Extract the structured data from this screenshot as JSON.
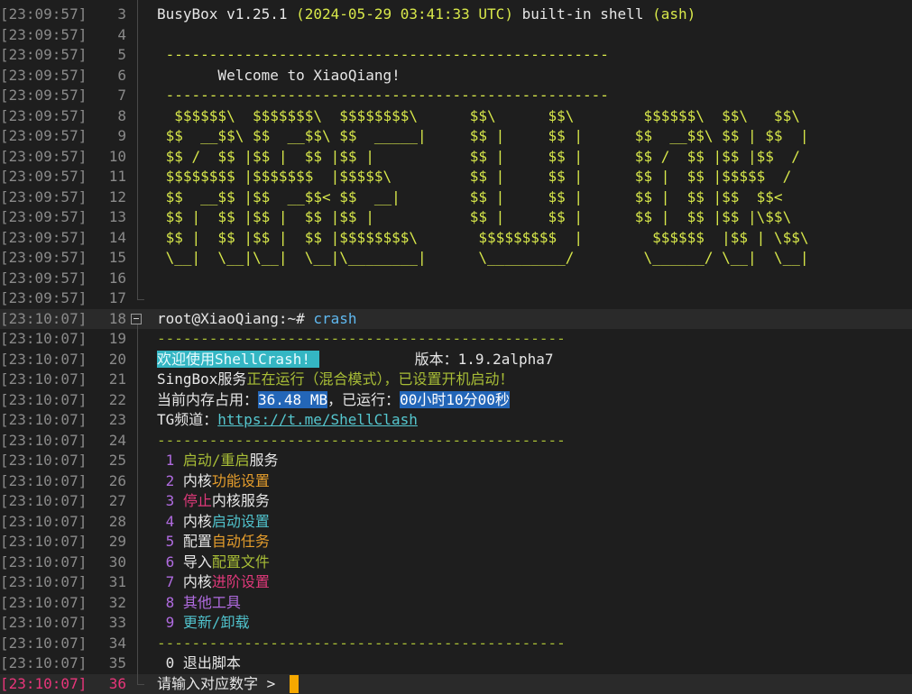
{
  "rows": [
    {
      "ts": "[23:09:57]",
      "ln": "3",
      "segs": [
        {
          "t": "BusyBox v1.25.1 ",
          "c": "c-white"
        },
        {
          "t": "(2024-05-29 03:41:33 UTC)",
          "c": "c-ygreen"
        },
        {
          "t": " built-in shell ",
          "c": "c-white"
        },
        {
          "t": "(ash)",
          "c": "c-ygreen"
        }
      ]
    },
    {
      "ts": "[23:09:57]",
      "ln": "4",
      "segs": []
    },
    {
      "ts": "[23:09:57]",
      "ln": "5",
      "segs": [
        {
          "t": " ---------------------------------------------------",
          "c": "c-ygreen"
        }
      ]
    },
    {
      "ts": "[23:09:57]",
      "ln": "6",
      "segs": [
        {
          "t": "       Welcome to XiaoQiang!",
          "c": "c-white"
        }
      ]
    },
    {
      "ts": "[23:09:57]",
      "ln": "7",
      "segs": [
        {
          "t": " ---------------------------------------------------",
          "c": "c-ygreen"
        }
      ]
    },
    {
      "ts": "[23:09:57]",
      "ln": "8",
      "segs": [
        {
          "t": "  $$$$$$\\  $$$$$$$\\  $$$$$$$$\\      $$\\      $$\\        $$$$$$\\  $$\\   $$\\",
          "c": "c-ygreen"
        }
      ]
    },
    {
      "ts": "[23:09:57]",
      "ln": "9",
      "segs": [
        {
          "t": " $$  __$$\\ $$  __$$\\ $$  _____|     $$ |     $$ |      $$  __$$\\ $$ | $$  |",
          "c": "c-ygreen"
        }
      ]
    },
    {
      "ts": "[23:09:57]",
      "ln": "10",
      "segs": [
        {
          "t": " $$ /  $$ |$$ |  $$ |$$ |           $$ |     $$ |      $$ /  $$ |$$ |$$  /",
          "c": "c-ygreen"
        }
      ]
    },
    {
      "ts": "[23:09:57]",
      "ln": "11",
      "segs": [
        {
          "t": " $$$$$$$$ |$$$$$$$  |$$$$$\\         $$ |     $$ |      $$ |  $$ |$$$$$  /",
          "c": "c-ygreen"
        }
      ]
    },
    {
      "ts": "[23:09:57]",
      "ln": "12",
      "segs": [
        {
          "t": " $$  __$$ |$$  __$$< $$  __|        $$ |     $$ |      $$ |  $$ |$$  $$<",
          "c": "c-ygreen"
        }
      ]
    },
    {
      "ts": "[23:09:57]",
      "ln": "13",
      "segs": [
        {
          "t": " $$ |  $$ |$$ |  $$ |$$ |           $$ |     $$ |      $$ |  $$ |$$ |\\$$\\",
          "c": "c-ygreen"
        }
      ]
    },
    {
      "ts": "[23:09:57]",
      "ln": "14",
      "segs": [
        {
          "t": " $$ |  $$ |$$ |  $$ |$$$$$$$$\\       $$$$$$$$$  |        $$$$$$  |$$ | \\$$\\",
          "c": "c-ygreen"
        }
      ]
    },
    {
      "ts": "[23:09:57]",
      "ln": "15",
      "segs": [
        {
          "t": " \\__|  \\__|\\__|  \\__|\\________|      \\_________/        \\______/ \\__|  \\__|",
          "c": "c-ygreen"
        }
      ]
    },
    {
      "ts": "[23:09:57]",
      "ln": "16",
      "segs": []
    },
    {
      "ts": "[23:09:57]",
      "ln": "17",
      "segs": []
    },
    {
      "ts": "[23:10:07]",
      "ln": "18",
      "segs": [
        {
          "t": "root@XiaoQiang:~# ",
          "c": "c-white"
        },
        {
          "t": "crash",
          "c": "c-blue"
        }
      ]
    },
    {
      "ts": "[23:10:07]",
      "ln": "19",
      "segs": [
        {
          "t": "-----------------------------------------------",
          "c": "c-olive"
        }
      ]
    },
    {
      "ts": "[23:10:07]",
      "ln": "20",
      "segs": [
        {
          "t": "欢迎使用ShellCrash! ",
          "c": "hl-cyan"
        },
        {
          "t": "           版本：1.9.2alpha7",
          "c": "c-white"
        }
      ]
    },
    {
      "ts": "[23:10:07]",
      "ln": "21",
      "segs": [
        {
          "t": "SingBox服务",
          "c": "c-white"
        },
        {
          "t": "正在运行（混合模式），已设置开机启动！",
          "c": "c-olive"
        }
      ]
    },
    {
      "ts": "[23:10:07]",
      "ln": "22",
      "segs": [
        {
          "t": "当前内存占用：",
          "c": "c-white"
        },
        {
          "t": "36.48 MB",
          "c": "hl-sel"
        },
        {
          "t": "，已运行：",
          "c": "c-white"
        },
        {
          "t": "00小时10分00秒",
          "c": "hl-sel"
        }
      ]
    },
    {
      "ts": "[23:10:07]",
      "ln": "23",
      "segs": [
        {
          "t": "TG频道：",
          "c": "c-white"
        },
        {
          "t": "https://t.me/ShellClash",
          "c": "c-link"
        }
      ]
    },
    {
      "ts": "[23:10:07]",
      "ln": "24",
      "segs": [
        {
          "t": "-----------------------------------------------",
          "c": "c-olive"
        }
      ]
    },
    {
      "ts": "[23:10:07]",
      "ln": "25",
      "segs": [
        {
          "t": " 1 ",
          "c": "c-purple"
        },
        {
          "t": "启动/重启",
          "c": "c-olive"
        },
        {
          "t": "服务",
          "c": "c-white"
        }
      ]
    },
    {
      "ts": "[23:10:07]",
      "ln": "26",
      "segs": [
        {
          "t": " 2 ",
          "c": "c-purple"
        },
        {
          "t": "内核",
          "c": "c-white"
        },
        {
          "t": "功能设置",
          "c": "c-orange"
        }
      ]
    },
    {
      "ts": "[23:10:07]",
      "ln": "27",
      "segs": [
        {
          "t": " 3 ",
          "c": "c-purple"
        },
        {
          "t": "停止",
          "c": "c-magenta"
        },
        {
          "t": "内核服务",
          "c": "c-white"
        }
      ]
    },
    {
      "ts": "[23:10:07]",
      "ln": "28",
      "segs": [
        {
          "t": " 4 ",
          "c": "c-purple"
        },
        {
          "t": "内核",
          "c": "c-white"
        },
        {
          "t": "启动设置",
          "c": "c-cyan"
        }
      ]
    },
    {
      "ts": "[23:10:07]",
      "ln": "29",
      "segs": [
        {
          "t": " 5 ",
          "c": "c-purple"
        },
        {
          "t": "配置",
          "c": "c-white"
        },
        {
          "t": "自动任务",
          "c": "c-orange"
        }
      ]
    },
    {
      "ts": "[23:10:07]",
      "ln": "30",
      "segs": [
        {
          "t": " 6 ",
          "c": "c-purple"
        },
        {
          "t": "导入",
          "c": "c-white"
        },
        {
          "t": "配置文件",
          "c": "c-olive"
        }
      ]
    },
    {
      "ts": "[23:10:07]",
      "ln": "31",
      "segs": [
        {
          "t": " 7 ",
          "c": "c-purple"
        },
        {
          "t": "内核",
          "c": "c-white"
        },
        {
          "t": "进阶设置",
          "c": "c-magenta"
        }
      ]
    },
    {
      "ts": "[23:10:07]",
      "ln": "32",
      "segs": [
        {
          "t": " 8 ",
          "c": "c-purple"
        },
        {
          "t": "其他工具",
          "c": "c-purple"
        }
      ]
    },
    {
      "ts": "[23:10:07]",
      "ln": "33",
      "segs": [
        {
          "t": " 9 ",
          "c": "c-purple"
        },
        {
          "t": "更新/卸载",
          "c": "c-cyan"
        }
      ]
    },
    {
      "ts": "[23:10:07]",
      "ln": "34",
      "segs": [
        {
          "t": "-----------------------------------------------",
          "c": "c-olive"
        }
      ]
    },
    {
      "ts": "[23:10:07]",
      "ln": "35",
      "segs": [
        {
          "t": " 0 ",
          "c": "c-white"
        },
        {
          "t": "退出脚本",
          "c": "c-white"
        }
      ]
    },
    {
      "ts": "[23:10:07]",
      "ln": "36",
      "segs": [
        {
          "t": "请输入对应数字 ",
          "c": "c-white"
        },
        {
          "t": "> ",
          "c": "c-white"
        }
      ]
    }
  ],
  "current_line": "36",
  "cursor_color": "#f5a800"
}
